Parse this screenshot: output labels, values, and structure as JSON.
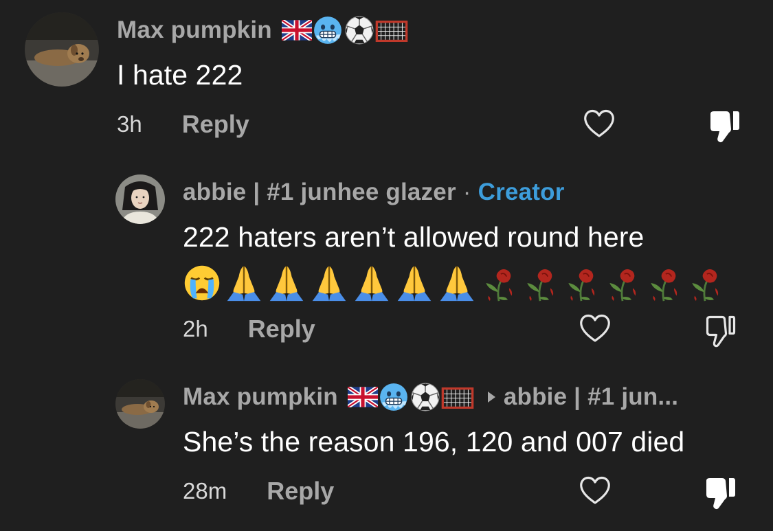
{
  "comments": [
    {
      "username": "Max pumpkin",
      "text": "I hate 222",
      "time": "3h",
      "reply_label": "Reply",
      "disliked": true
    },
    {
      "username": "abbie | #1 junhee glazer",
      "separator": "·",
      "creator_label": "Creator",
      "text": "222 haters aren’t allowed round here",
      "time": "2h",
      "reply_label": "Reply",
      "disliked": false
    },
    {
      "username": "Max pumpkin",
      "reply_to": "abbie | #1 jun...",
      "text": "She’s the reason 196, 120 and 007 died",
      "time": "28m",
      "reply_label": "Reply",
      "disliked": true
    }
  ],
  "badges": [
    "uk-flag-icon",
    "cold-face-icon",
    "soccer-ball-icon",
    "goal-net-icon"
  ],
  "reply_emojis": [
    "loudly-crying-face-icon",
    "folded-hands-icon",
    "folded-hands-icon",
    "folded-hands-icon",
    "folded-hands-icon",
    "folded-hands-icon",
    "folded-hands-icon",
    "wilted-flower-icon",
    "wilted-flower-icon",
    "wilted-flower-icon",
    "wilted-flower-icon",
    "wilted-flower-icon",
    "wilted-flower-icon"
  ],
  "colors": {
    "background": "#1f1f1f",
    "username": "#a8a8a8",
    "creator": "#3d9ddb",
    "text": "#ffffff"
  }
}
